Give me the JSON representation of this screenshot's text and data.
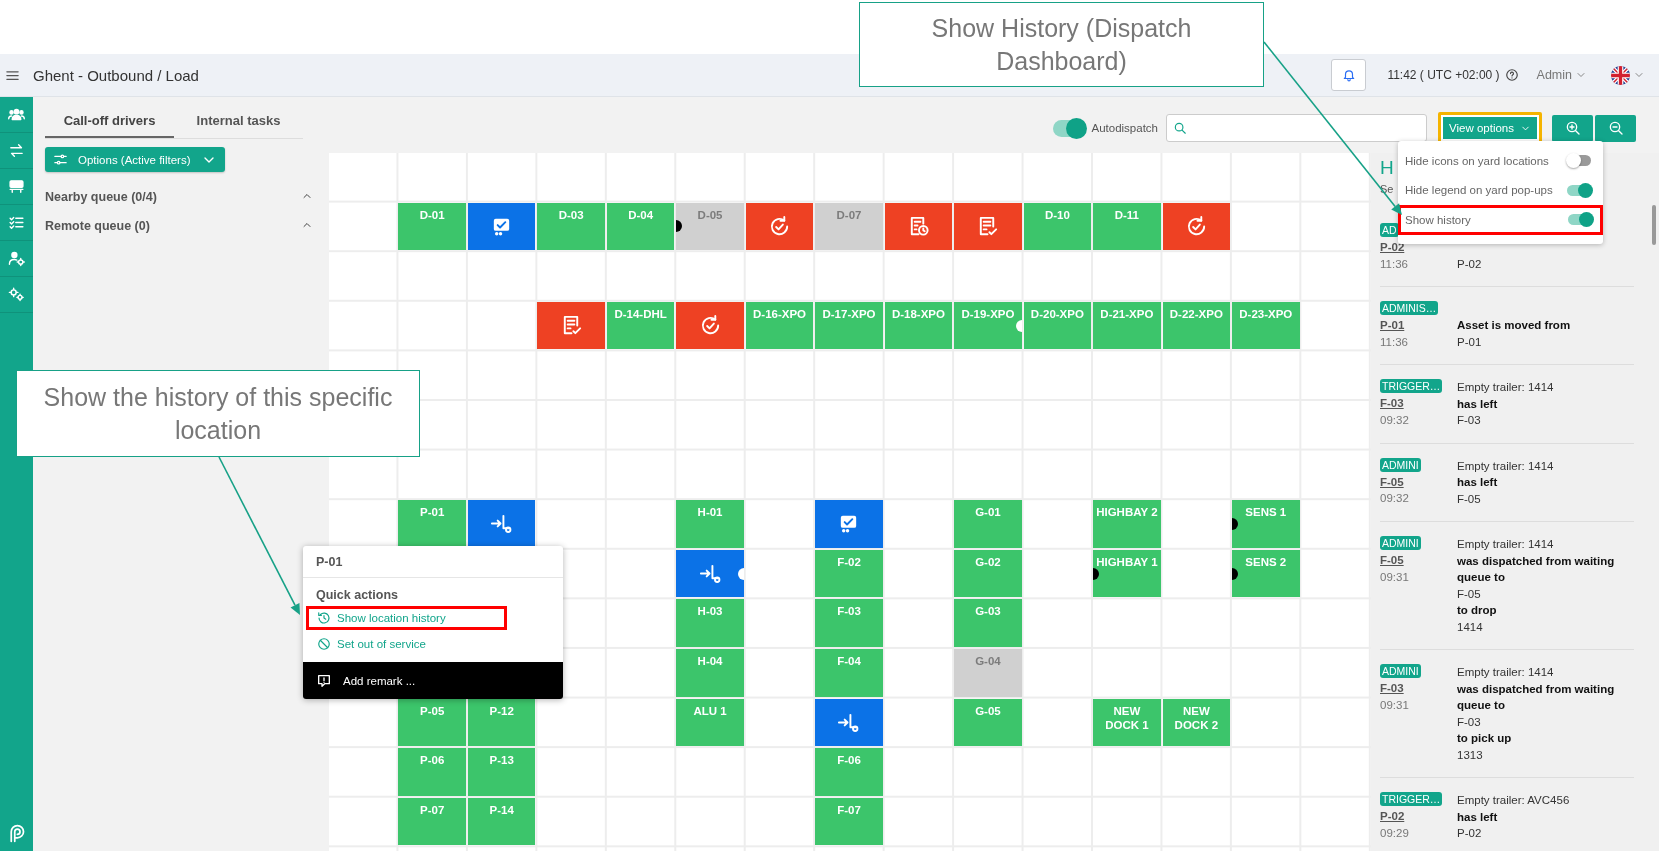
{
  "header": {
    "title": "Ghent - Outbound / Load",
    "time": "11:42 ( UTC +02:00 )",
    "user": "Admin"
  },
  "left_panel": {
    "tabs": [
      {
        "label": "Call-off drivers",
        "selected": true
      },
      {
        "label": "Internal tasks",
        "selected": false
      }
    ],
    "options_button": "Options (Active filters)",
    "queues": [
      {
        "label": "Nearby queue (0/4)",
        "expanded": true
      },
      {
        "label": "Remote queue (0)",
        "expanded": true
      }
    ]
  },
  "toolbar": {
    "autodispatch": {
      "label": "Autodispatch",
      "on": true
    },
    "view_options": "View options"
  },
  "view_menu": {
    "items": [
      {
        "label": "Hide icons on yard locations",
        "on": false
      },
      {
        "label": "Hide legend on yard pop-ups",
        "on": true
      },
      {
        "label": "Show history",
        "on": true
      }
    ]
  },
  "grid": {
    "rows": [
      {
        "cells": [
          {
            "kind": "empty"
          },
          {
            "kind": "empty"
          },
          {
            "kind": "empty"
          },
          {
            "kind": "empty"
          },
          {
            "kind": "empty"
          },
          {
            "kind": "empty"
          },
          {
            "kind": "empty"
          },
          {
            "kind": "empty"
          },
          {
            "kind": "empty"
          },
          {
            "kind": "empty"
          },
          {
            "kind": "empty"
          },
          {
            "kind": "empty"
          },
          {
            "kind": "empty"
          },
          {
            "kind": "empty"
          },
          {
            "kind": "empty"
          }
        ]
      },
      {
        "cells": [
          {
            "kind": "empty"
          },
          {
            "kind": "location",
            "label": "D-01",
            "disabled": false
          },
          {
            "kind": "delivered",
            "color": "#0b72e7"
          },
          {
            "kind": "location",
            "label": "D-03",
            "disabled": false
          },
          {
            "kind": "location",
            "label": "D-04",
            "disabled": false
          },
          {
            "kind": "location",
            "label": "D-05",
            "disabled": true,
            "left_dot": true
          },
          {
            "kind": "reload",
            "color": "#ee4123"
          },
          {
            "kind": "location",
            "label": "D-07",
            "disabled": true
          },
          {
            "kind": "doc-pending",
            "color": "#ee4123"
          },
          {
            "kind": "doc-approved",
            "color": "#ee4123"
          },
          {
            "kind": "location",
            "label": "D-10",
            "disabled": false
          },
          {
            "kind": "location",
            "label": "D-11",
            "disabled": false
          },
          {
            "kind": "reload",
            "color": "#ee4123"
          },
          {
            "kind": "empty"
          },
          {
            "kind": "empty"
          }
        ]
      },
      {
        "cells": [
          {
            "kind": "empty"
          },
          {
            "kind": "empty"
          },
          {
            "kind": "empty"
          },
          {
            "kind": "empty"
          },
          {
            "kind": "empty"
          },
          {
            "kind": "empty"
          },
          {
            "kind": "empty"
          },
          {
            "kind": "empty"
          },
          {
            "kind": "empty"
          },
          {
            "kind": "empty"
          },
          {
            "kind": "empty"
          },
          {
            "kind": "empty"
          },
          {
            "kind": "empty"
          },
          {
            "kind": "empty"
          },
          {
            "kind": "empty"
          }
        ]
      },
      {
        "cells": [
          {
            "kind": "empty"
          },
          {
            "kind": "empty"
          },
          {
            "kind": "empty"
          },
          {
            "kind": "doc-approved",
            "color": "#ee4123"
          },
          {
            "kind": "location",
            "label": "D-14-DHL",
            "disabled": false
          },
          {
            "kind": "reload",
            "color": "#ee4123"
          },
          {
            "kind": "location",
            "label": "D-16-XPO",
            "disabled": false
          },
          {
            "kind": "location",
            "label": "D-17-XPO",
            "disabled": false
          },
          {
            "kind": "location",
            "label": "D-18-XPO",
            "disabled": false
          },
          {
            "kind": "location",
            "label": "D-19-XPO",
            "disabled": false,
            "right_dot": true
          },
          {
            "kind": "location",
            "label": "D-20-XPO",
            "disabled": false
          },
          {
            "kind": "location",
            "label": "D-21-XPO",
            "disabled": false
          },
          {
            "kind": "location",
            "label": "D-22-XPO",
            "disabled": false
          },
          {
            "kind": "location",
            "label": "D-23-XPO",
            "disabled": false
          },
          {
            "kind": "empty"
          }
        ]
      },
      {
        "cells": [
          {
            "kind": "empty"
          },
          {
            "kind": "empty"
          },
          {
            "kind": "empty"
          },
          {
            "kind": "empty"
          },
          {
            "kind": "empty"
          },
          {
            "kind": "empty"
          },
          {
            "kind": "empty"
          },
          {
            "kind": "empty"
          },
          {
            "kind": "empty"
          },
          {
            "kind": "empty"
          },
          {
            "kind": "empty"
          },
          {
            "kind": "empty"
          },
          {
            "kind": "empty"
          },
          {
            "kind": "empty"
          },
          {
            "kind": "empty"
          }
        ]
      },
      {
        "cells": [
          {
            "kind": "empty"
          },
          {
            "kind": "empty"
          },
          {
            "kind": "empty"
          },
          {
            "kind": "empty"
          },
          {
            "kind": "empty"
          },
          {
            "kind": "empty"
          },
          {
            "kind": "empty"
          },
          {
            "kind": "empty"
          },
          {
            "kind": "empty"
          },
          {
            "kind": "empty"
          },
          {
            "kind": "empty"
          },
          {
            "kind": "empty"
          },
          {
            "kind": "empty"
          },
          {
            "kind": "empty"
          },
          {
            "kind": "empty"
          }
        ]
      },
      {
        "cells": [
          {
            "kind": "empty"
          },
          {
            "kind": "empty"
          },
          {
            "kind": "empty"
          },
          {
            "kind": "empty"
          },
          {
            "kind": "empty"
          },
          {
            "kind": "empty"
          },
          {
            "kind": "empty"
          },
          {
            "kind": "empty"
          },
          {
            "kind": "empty"
          },
          {
            "kind": "empty"
          },
          {
            "kind": "empty"
          },
          {
            "kind": "empty"
          },
          {
            "kind": "empty"
          },
          {
            "kind": "empty"
          },
          {
            "kind": "empty"
          }
        ]
      },
      {
        "cells": [
          {
            "kind": "empty"
          },
          {
            "kind": "location",
            "label": "P-01",
            "disabled": false
          },
          {
            "kind": "transfer",
            "color": "#0b72e7"
          },
          {
            "kind": "empty"
          },
          {
            "kind": "empty"
          },
          {
            "kind": "location",
            "label": "H-01",
            "disabled": false
          },
          {
            "kind": "empty"
          },
          {
            "kind": "delivered",
            "color": "#0b72e7"
          },
          {
            "kind": "empty"
          },
          {
            "kind": "location",
            "label": "G-01",
            "disabled": false
          },
          {
            "kind": "empty"
          },
          {
            "kind": "location",
            "label": "HIGHBAY 2",
            "disabled": false
          },
          {
            "kind": "empty"
          },
          {
            "kind": "location",
            "label": "SENS 1",
            "disabled": false,
            "left_dot": true
          },
          {
            "kind": "empty"
          }
        ]
      },
      {
        "cells": [
          {
            "kind": "empty"
          },
          {
            "kind": "empty"
          },
          {
            "kind": "empty"
          },
          {
            "kind": "empty"
          },
          {
            "kind": "empty"
          },
          {
            "kind": "transfer",
            "color": "#0b72e7",
            "right_dot": true
          },
          {
            "kind": "empty"
          },
          {
            "kind": "location",
            "label": "F-02",
            "disabled": false
          },
          {
            "kind": "empty"
          },
          {
            "kind": "location",
            "label": "G-02",
            "disabled": false
          },
          {
            "kind": "empty"
          },
          {
            "kind": "location",
            "label": "HIGHBAY 1",
            "disabled": false,
            "left_dot": true
          },
          {
            "kind": "empty"
          },
          {
            "kind": "location",
            "label": "SENS 2",
            "disabled": false,
            "left_dot": true
          },
          {
            "kind": "empty"
          }
        ]
      },
      {
        "cells": [
          {
            "kind": "empty"
          },
          {
            "kind": "empty"
          },
          {
            "kind": "empty"
          },
          {
            "kind": "empty"
          },
          {
            "kind": "empty"
          },
          {
            "kind": "location",
            "label": "H-03",
            "disabled": false
          },
          {
            "kind": "empty"
          },
          {
            "kind": "location",
            "label": "F-03",
            "disabled": false
          },
          {
            "kind": "empty"
          },
          {
            "kind": "location",
            "label": "G-03",
            "disabled": false
          },
          {
            "kind": "empty"
          },
          {
            "kind": "empty"
          },
          {
            "kind": "empty"
          },
          {
            "kind": "empty"
          },
          {
            "kind": "empty"
          }
        ]
      },
      {
        "cells": [
          {
            "kind": "empty"
          },
          {
            "kind": "empty"
          },
          {
            "kind": "empty"
          },
          {
            "kind": "empty"
          },
          {
            "kind": "empty"
          },
          {
            "kind": "location",
            "label": "H-04",
            "disabled": false
          },
          {
            "kind": "empty"
          },
          {
            "kind": "location",
            "label": "F-04",
            "disabled": false
          },
          {
            "kind": "empty"
          },
          {
            "kind": "location",
            "label": "G-04",
            "disabled": true
          },
          {
            "kind": "empty"
          },
          {
            "kind": "empty"
          },
          {
            "kind": "empty"
          },
          {
            "kind": "empty"
          },
          {
            "kind": "empty"
          }
        ]
      },
      {
        "cells": [
          {
            "kind": "empty"
          },
          {
            "kind": "location",
            "label": "P-05",
            "disabled": false
          },
          {
            "kind": "location",
            "label": "P-12",
            "disabled": false
          },
          {
            "kind": "empty"
          },
          {
            "kind": "empty"
          },
          {
            "kind": "location",
            "label": "ALU 1",
            "disabled": false
          },
          {
            "kind": "empty"
          },
          {
            "kind": "transfer",
            "color": "#0b72e7"
          },
          {
            "kind": "empty"
          },
          {
            "kind": "location",
            "label": "G-05",
            "disabled": false
          },
          {
            "kind": "empty"
          },
          {
            "kind": "location",
            "label": "NEW DOCK 1",
            "disabled": false
          },
          {
            "kind": "location",
            "label": "NEW DOCK 2",
            "disabled": false
          },
          {
            "kind": "empty"
          },
          {
            "kind": "empty"
          }
        ]
      },
      {
        "cells": [
          {
            "kind": "empty"
          },
          {
            "kind": "location",
            "label": "P-06",
            "disabled": false
          },
          {
            "kind": "location",
            "label": "P-13",
            "disabled": false
          },
          {
            "kind": "empty"
          },
          {
            "kind": "empty"
          },
          {
            "kind": "empty"
          },
          {
            "kind": "empty"
          },
          {
            "kind": "location",
            "label": "F-06",
            "disabled": false
          },
          {
            "kind": "empty"
          },
          {
            "kind": "empty"
          },
          {
            "kind": "empty"
          },
          {
            "kind": "empty"
          },
          {
            "kind": "empty"
          },
          {
            "kind": "empty"
          },
          {
            "kind": "empty"
          }
        ]
      },
      {
        "cells": [
          {
            "kind": "empty"
          },
          {
            "kind": "location",
            "label": "P-07",
            "disabled": false
          },
          {
            "kind": "location",
            "label": "P-14",
            "disabled": false
          },
          {
            "kind": "empty"
          },
          {
            "kind": "empty"
          },
          {
            "kind": "empty"
          },
          {
            "kind": "empty"
          },
          {
            "kind": "location",
            "label": "F-07",
            "disabled": false
          },
          {
            "kind": "empty"
          },
          {
            "kind": "empty"
          },
          {
            "kind": "empty"
          },
          {
            "kind": "empty"
          },
          {
            "kind": "empty"
          },
          {
            "kind": "empty"
          },
          {
            "kind": "empty"
          }
        ]
      }
    ]
  },
  "popup": {
    "title": "P-01",
    "section": "Quick actions",
    "actions": [
      {
        "label": "Show location history",
        "kind": "history"
      },
      {
        "label": "Set out of service",
        "kind": "disable"
      }
    ],
    "remark_placeholder": "Add remark ..."
  },
  "history": {
    "title": "H",
    "search_hint": "Se",
    "entries": [
      {
        "badge": "AD",
        "location": "P-02",
        "time": "11:36",
        "lines": [
          {
            "text": "P-02",
            "bold": false
          }
        ]
      },
      {
        "badge": "ADMINIS…",
        "location": "P-01",
        "time": "11:36",
        "lines": [
          {
            "text": "Asset is moved from",
            "bold": true
          },
          {
            "text": "P-01",
            "bold": false
          }
        ]
      },
      {
        "badge": "TRIGGER…",
        "location": "F-03",
        "time": "09:32",
        "lines": [
          {
            "text": "Empty trailer: 1414",
            "bold": false
          },
          {
            "text": "has left",
            "bold": true
          },
          {
            "text": "F-03",
            "bold": false
          }
        ]
      },
      {
        "badge": "ADMINI",
        "location": "F-05",
        "time": "09:32",
        "lines": [
          {
            "text": "Empty trailer: 1414",
            "bold": false
          },
          {
            "text": "has left",
            "bold": true
          },
          {
            "text": "F-05",
            "bold": false
          }
        ]
      },
      {
        "badge": "ADMINI",
        "location": "F-05",
        "time": "09:31",
        "lines": [
          {
            "text": "Empty trailer: 1414",
            "bold": false
          },
          {
            "text": "was dispatched from waiting queue to",
            "bold": true
          },
          {
            "text": "F-05",
            "bold": false
          },
          {
            "text": "to drop",
            "bold": true
          },
          {
            "text": "1414",
            "bold": false
          }
        ]
      },
      {
        "badge": "ADMINI",
        "location": "F-03",
        "time": "09:31",
        "lines": [
          {
            "text": "Empty trailer: 1414",
            "bold": false
          },
          {
            "text": "was dispatched from waiting queue to",
            "bold": true
          },
          {
            "text": "F-03",
            "bold": false
          },
          {
            "text": "to pick up",
            "bold": true
          },
          {
            "text": "1313",
            "bold": false
          }
        ]
      },
      {
        "badge": "TRIGGER…",
        "location": "P-02",
        "time": "09:29",
        "lines": [
          {
            "text": "Empty trailer: AVC456",
            "bold": false
          },
          {
            "text": "has left",
            "bold": true
          },
          {
            "text": "P-02",
            "bold": false
          }
        ]
      }
    ]
  },
  "annotations": {
    "callouts": [
      {
        "text": "Show History (Dispatch Dashboard)"
      },
      {
        "text": "Show the history of this specific location"
      }
    ],
    "frames": [
      {
        "color": "#f5b400"
      },
      {
        "color": "#ff0000"
      },
      {
        "color": "#ff0000"
      }
    ]
  }
}
